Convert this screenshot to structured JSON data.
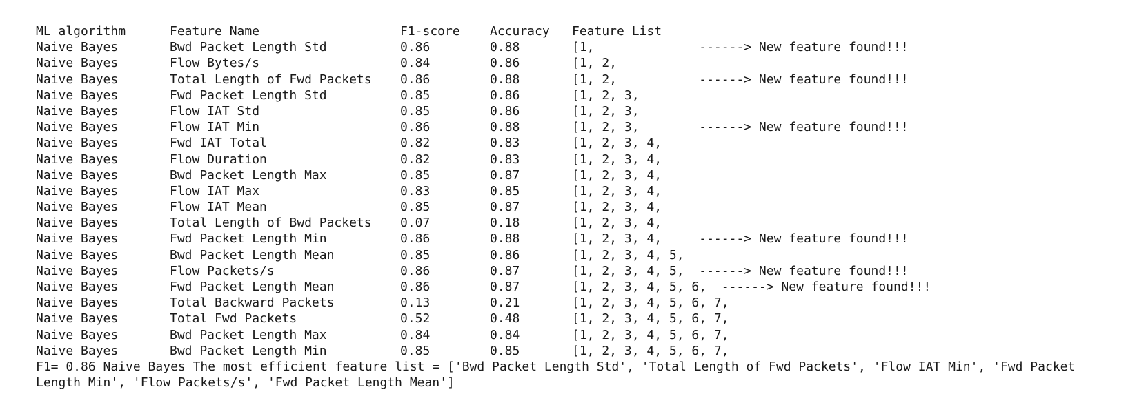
{
  "header": {
    "algorithm": "ML algorithm",
    "feature_name": "Feature Name",
    "f1": "F1-score",
    "accuracy": "Accuracy",
    "feature_list": "Feature List"
  },
  "rows": [
    {
      "alg": "Naive Bayes",
      "feature": "Bwd Packet Length Std",
      "f1": "0.86",
      "acc": "0.88",
      "list": "[1,              ------> New feature found!!!"
    },
    {
      "alg": "Naive Bayes",
      "feature": "Flow Bytes/s",
      "f1": "0.84",
      "acc": "0.86",
      "list": "[1, 2,"
    },
    {
      "alg": "Naive Bayes",
      "feature": "Total Length of Fwd Packets",
      "f1": "0.86",
      "acc": "0.88",
      "list": "[1, 2,           ------> New feature found!!!"
    },
    {
      "alg": "Naive Bayes",
      "feature": "Fwd Packet Length Std",
      "f1": "0.85",
      "acc": "0.86",
      "list": "[1, 2, 3,"
    },
    {
      "alg": "Naive Bayes",
      "feature": "Flow IAT Std",
      "f1": "0.85",
      "acc": "0.86",
      "list": "[1, 2, 3,"
    },
    {
      "alg": "Naive Bayes",
      "feature": "Flow IAT Min",
      "f1": "0.86",
      "acc": "0.88",
      "list": "[1, 2, 3,        ------> New feature found!!!"
    },
    {
      "alg": "Naive Bayes",
      "feature": "Fwd IAT Total",
      "f1": "0.82",
      "acc": "0.83",
      "list": "[1, 2, 3, 4,"
    },
    {
      "alg": "Naive Bayes",
      "feature": "Flow Duration",
      "f1": "0.82",
      "acc": "0.83",
      "list": "[1, 2, 3, 4,"
    },
    {
      "alg": "Naive Bayes",
      "feature": "Bwd Packet Length Max",
      "f1": "0.85",
      "acc": "0.87",
      "list": "[1, 2, 3, 4,"
    },
    {
      "alg": "Naive Bayes",
      "feature": "Flow IAT Max",
      "f1": "0.83",
      "acc": "0.85",
      "list": "[1, 2, 3, 4,"
    },
    {
      "alg": "Naive Bayes",
      "feature": "Flow IAT Mean",
      "f1": "0.85",
      "acc": "0.87",
      "list": "[1, 2, 3, 4,"
    },
    {
      "alg": "Naive Bayes",
      "feature": "Total Length of Bwd Packets",
      "f1": "0.07",
      "acc": "0.18",
      "list": "[1, 2, 3, 4,"
    },
    {
      "alg": "Naive Bayes",
      "feature": "Fwd Packet Length Min",
      "f1": "0.86",
      "acc": "0.88",
      "list": "[1, 2, 3, 4,     ------> New feature found!!!"
    },
    {
      "alg": "Naive Bayes",
      "feature": "Bwd Packet Length Mean",
      "f1": "0.85",
      "acc": "0.86",
      "list": "[1, 2, 3, 4, 5,"
    },
    {
      "alg": "Naive Bayes",
      "feature": "Flow Packets/s",
      "f1": "0.86",
      "acc": "0.87",
      "list": "[1, 2, 3, 4, 5,  ------> New feature found!!!"
    },
    {
      "alg": "Naive Bayes",
      "feature": "Fwd Packet Length Mean",
      "f1": "0.86",
      "acc": "0.87",
      "list": "[1, 2, 3, 4, 5, 6,  ------> New feature found!!!"
    },
    {
      "alg": "Naive Bayes",
      "feature": "Total Backward Packets",
      "f1": "0.13",
      "acc": "0.21",
      "list": "[1, 2, 3, 4, 5, 6, 7,"
    },
    {
      "alg": "Naive Bayes",
      "feature": "Total Fwd Packets",
      "f1": "0.52",
      "acc": "0.48",
      "list": "[1, 2, 3, 4, 5, 6, 7,"
    },
    {
      "alg": "Naive Bayes",
      "feature": "Bwd Packet Length Max",
      "f1": "0.84",
      "acc": "0.84",
      "list": "[1, 2, 3, 4, 5, 6, 7,"
    },
    {
      "alg": "Naive Bayes",
      "feature": "Bwd Packet Length Min",
      "f1": "0.85",
      "acc": "0.85",
      "list": "[1, 2, 3, 4, 5, 6, 7,"
    }
  ],
  "summary": "F1= 0.86 Naive Bayes  The most efficient feature list = ['Bwd Packet Length Std', 'Total Length of Fwd Packets', 'Flow IAT Min', 'Fwd Packet Length Min', 'Flow Packets/s', 'Fwd Packet Length Mean']"
}
